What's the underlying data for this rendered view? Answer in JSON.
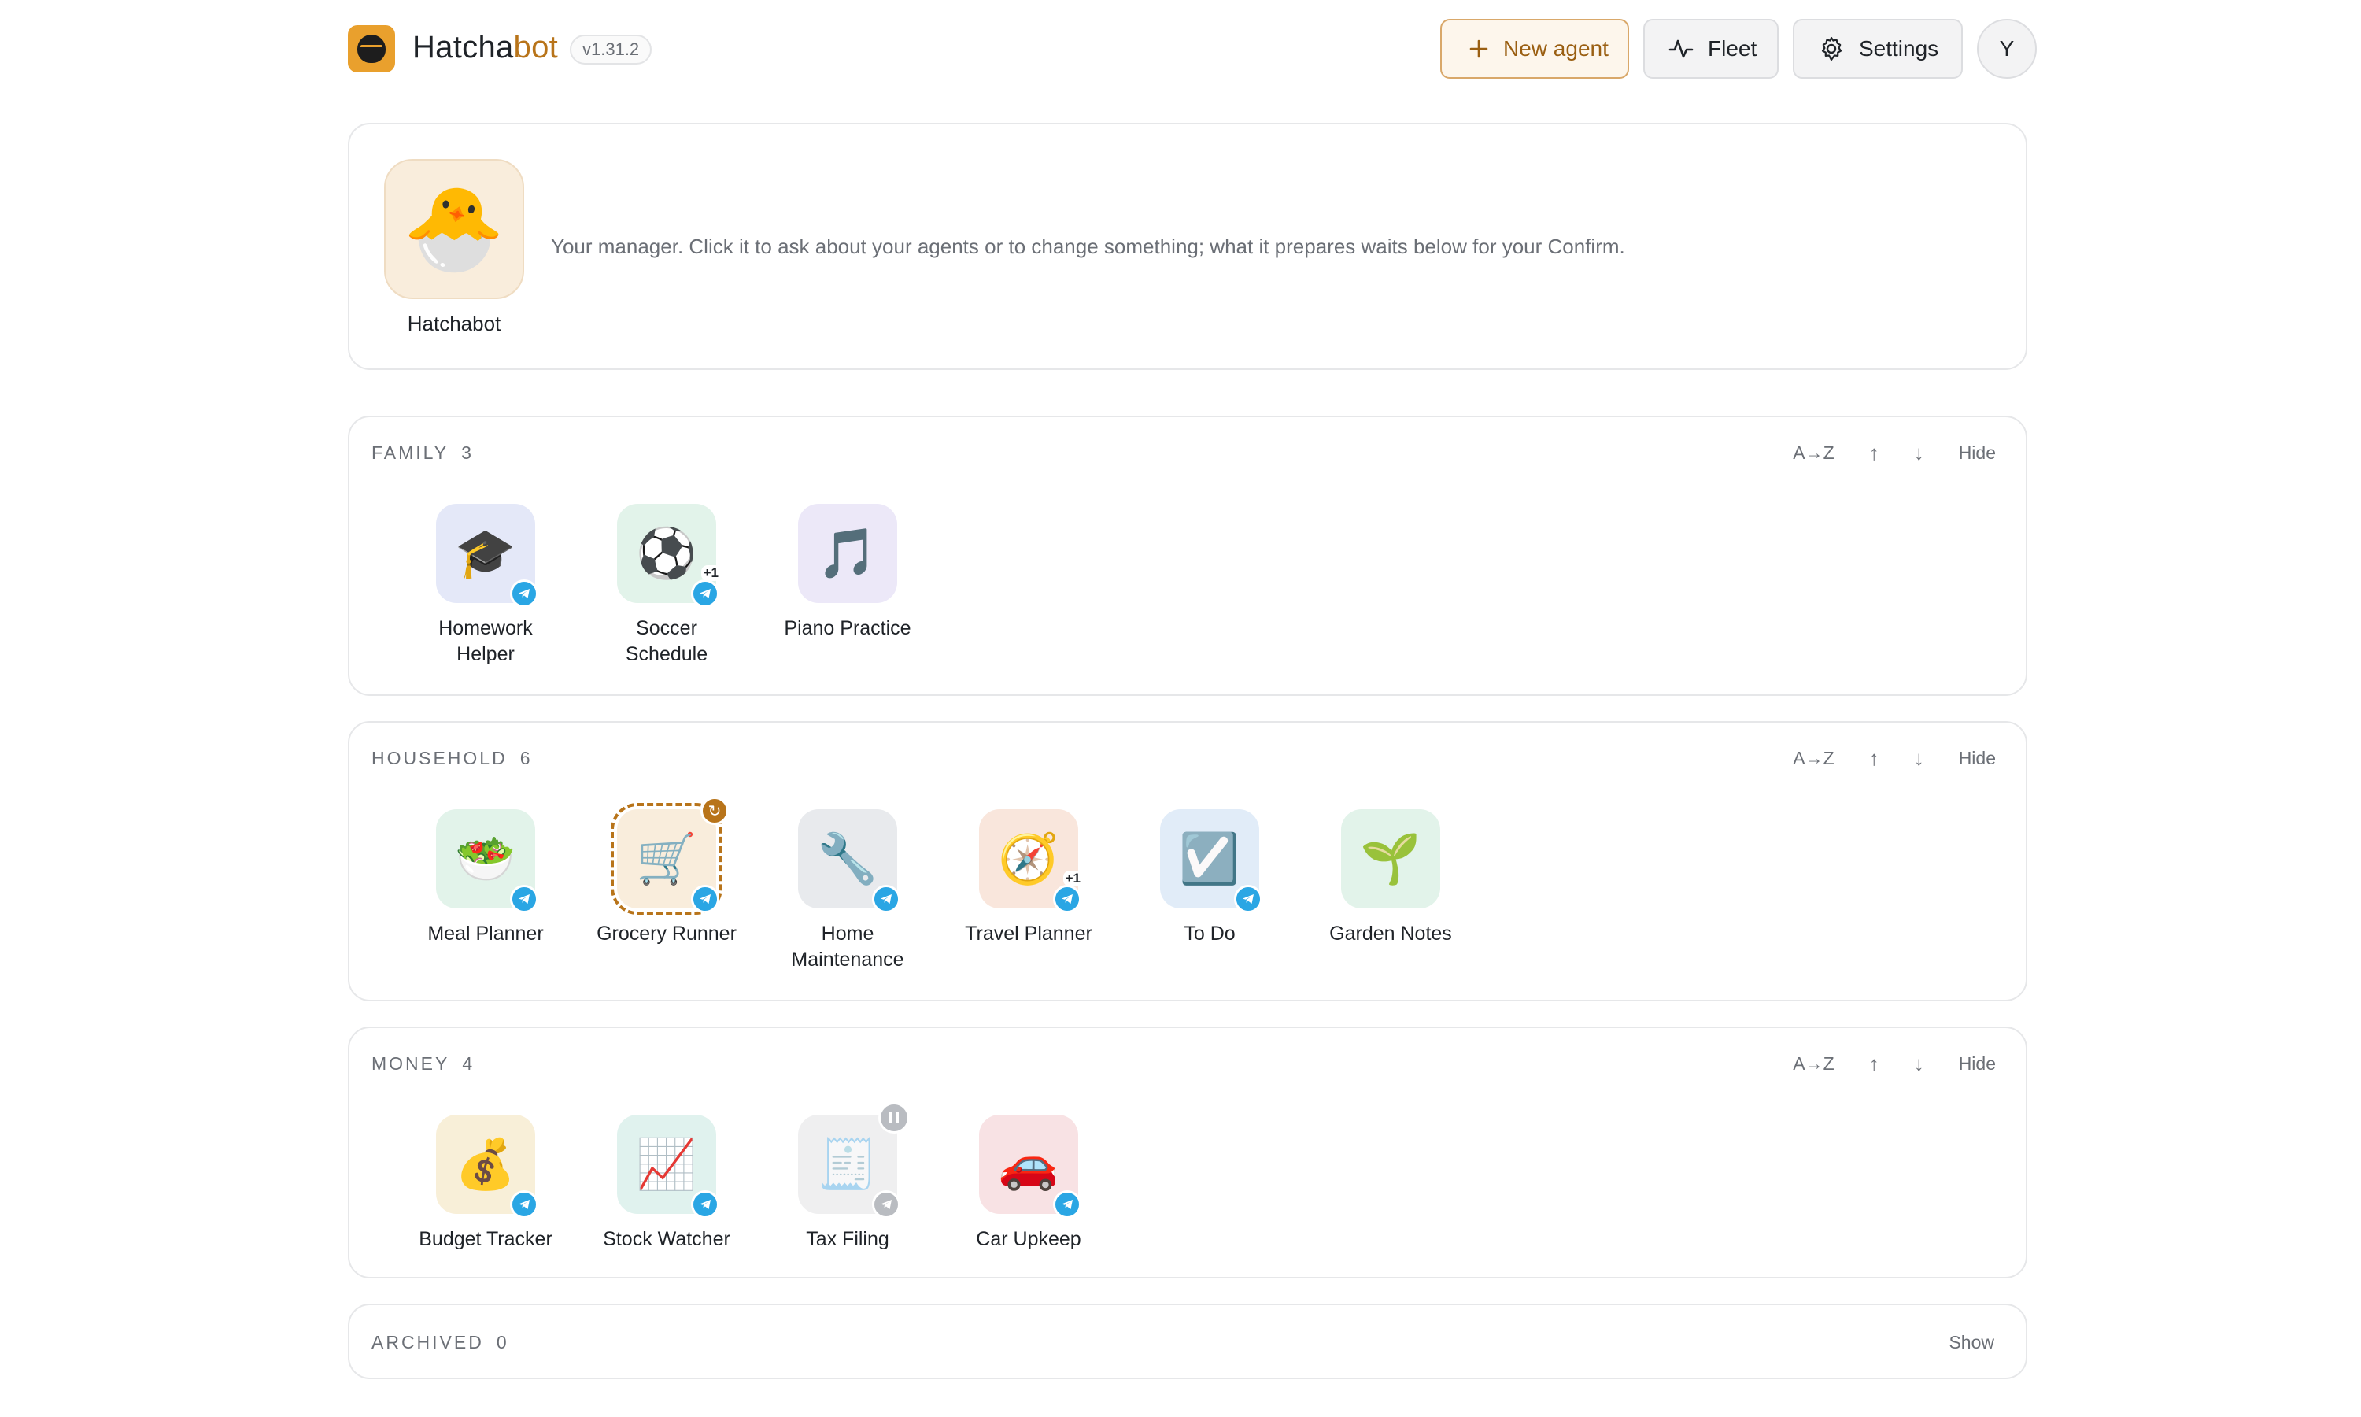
{
  "header": {
    "brand_main": "Hatcha",
    "brand_accent": "bot",
    "version": "v1.31.2",
    "new_agent_label": "New agent",
    "fleet_label": "Fleet",
    "settings_label": "Settings",
    "avatar_initial": "Y"
  },
  "manager": {
    "name": "Hatchabot",
    "emoji": "🐣",
    "description": "Your manager. Click it to ask about your agents or to change something; what it prepares waits below for your Confirm."
  },
  "controls": {
    "sort_az": "A→Z",
    "move_up": "↑",
    "move_down": "↓",
    "hide": "Hide",
    "show": "Show"
  },
  "groups": [
    {
      "title": "FAMILY",
      "count": "3",
      "agents": [
        {
          "name": "Homework Helper",
          "emoji": "🎓",
          "bg": "#e4e8f8",
          "telegram": true
        },
        {
          "name": "Soccer Schedule",
          "emoji": "⚽",
          "bg": "#e2f3ea",
          "telegram": true,
          "extra": "+1"
        },
        {
          "name": "Piano Practice",
          "emoji": "🎵",
          "bg": "#ece8f8",
          "telegram": false
        }
      ]
    },
    {
      "title": "HOUSEHOLD",
      "count": "6",
      "agents": [
        {
          "name": "Meal Planner",
          "emoji": "🥗",
          "bg": "#e2f3ea",
          "telegram": true
        },
        {
          "name": "Grocery Runner",
          "emoji": "🛒",
          "bg": "#f9eddc",
          "telegram": true,
          "status": "running"
        },
        {
          "name": "Home Maintenance",
          "emoji": "🔧",
          "bg": "#e8eaed",
          "telegram": true
        },
        {
          "name": "Travel Planner",
          "emoji": "🧭",
          "bg": "#f9e6dc",
          "telegram": true,
          "extra": "+1"
        },
        {
          "name": "To Do",
          "emoji": "☑️",
          "bg": "#e1ecf8",
          "telegram": true
        },
        {
          "name": "Garden Notes",
          "emoji": "🌱",
          "bg": "#e2f3ea",
          "telegram": false
        }
      ]
    },
    {
      "title": "MONEY",
      "count": "4",
      "agents": [
        {
          "name": "Budget Tracker",
          "emoji": "💰",
          "bg": "#f8efd8",
          "telegram": true
        },
        {
          "name": "Stock Watcher",
          "emoji": "📈",
          "bg": "#e0f2ee",
          "telegram": true
        },
        {
          "name": "Tax Filing",
          "emoji": "🧾",
          "bg": "#efeff0",
          "telegram": true,
          "status": "paused"
        },
        {
          "name": "Car Upkeep",
          "emoji": "🚗",
          "bg": "#f8e2e4",
          "telegram": true
        }
      ]
    }
  ],
  "archived": {
    "title": "ARCHIVED",
    "count": "0"
  },
  "colors": {
    "accent": "#b8741a",
    "telegram": "#2aa6e4",
    "paused": "#b9bcc1"
  }
}
